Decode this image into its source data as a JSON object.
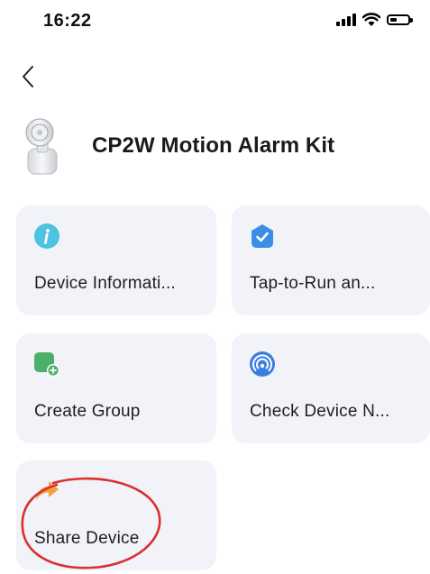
{
  "status_bar": {
    "time": "16:22"
  },
  "header": {
    "device_name": "CP2W Motion Alarm Kit"
  },
  "cards": [
    {
      "label": "Device Informati...",
      "icon": "info-icon",
      "color": "#4cc3e0"
    },
    {
      "label": "Tap-to-Run an...",
      "icon": "automation-check-icon",
      "color": "#3a8ee6"
    },
    {
      "label": "Create Group",
      "icon": "create-group-icon",
      "color": "#4caf6a"
    },
    {
      "label": "Check Device N...",
      "icon": "network-signal-icon",
      "color": "#3a7fe0"
    },
    {
      "label": "Share Device",
      "icon": "share-icon",
      "color": "#f2a33c"
    }
  ],
  "annotation": {
    "highlight_color": "#d93030"
  }
}
